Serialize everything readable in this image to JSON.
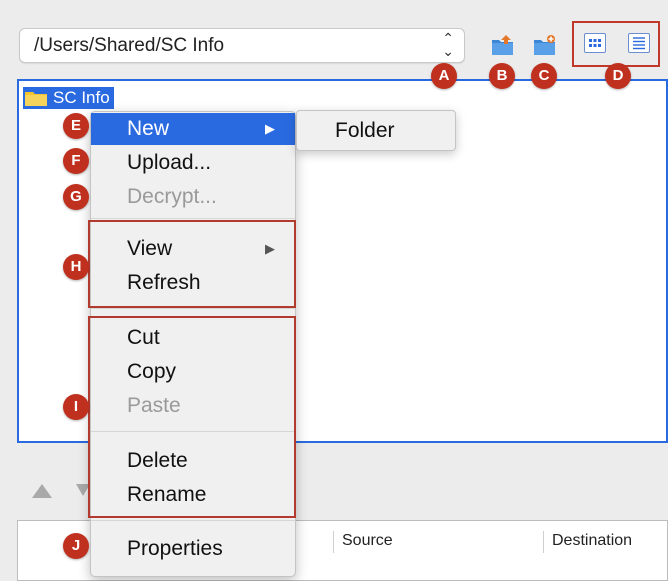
{
  "path_selector": {
    "value": "/Users/Shared/SC Info"
  },
  "toolbar": {
    "upload_icon": "upload-folder-icon",
    "new_folder_icon": "new-folder-icon",
    "icon_view": "grid-view-icon",
    "list_view": "list-view-icon"
  },
  "tree": {
    "root_label": "SC Info"
  },
  "context_menu": {
    "new": "New",
    "upload": "Upload...",
    "decrypt": "Decrypt...",
    "view": "View",
    "refresh": "Refresh",
    "cut": "Cut",
    "copy": "Copy",
    "paste": "Paste",
    "delete": "Delete",
    "rename": "Rename",
    "properties": "Properties",
    "submenu_arrow": "▶"
  },
  "submenu": {
    "folder": "Folder"
  },
  "transfers": {
    "col_source": "Source",
    "col_destination": "Destination"
  },
  "callouts": [
    "A",
    "B",
    "C",
    "D",
    "E",
    "F",
    "G",
    "H",
    "I",
    "J"
  ],
  "colors": {
    "selection": "#2a6ae0",
    "callout": "#c0301f",
    "highlight_box": "#b23a2e"
  }
}
